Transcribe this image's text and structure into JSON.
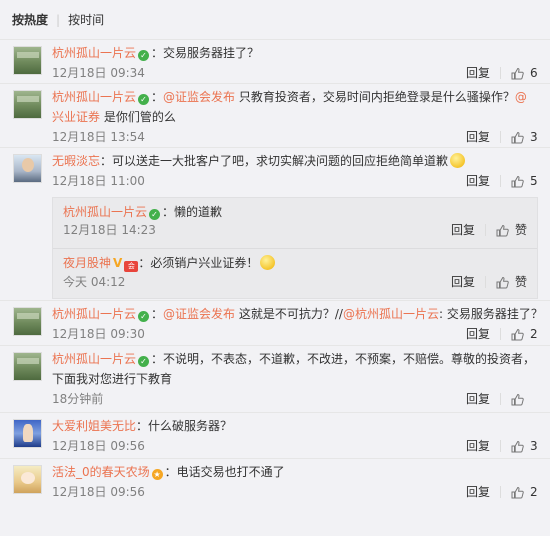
{
  "sort": {
    "hot": "按热度",
    "time": "按时间"
  },
  "comments": [
    {
      "name": "杭州孤山一片云",
      "content": "：交易服务器挂了？",
      "time": "12月18日 09:34",
      "reply": "回复",
      "likes": "6"
    },
    {
      "name": "杭州孤山一片云",
      "mention1": "@证监会发布",
      "content1": " 只教育投资者，交易时间内拒绝登录是什么骚操作？",
      "mention2": "@兴业证券",
      "content2": " 是你们管的么",
      "time": "12月18日 13:54",
      "reply": "回复",
      "likes": "3"
    },
    {
      "name": "无暇淡忘",
      "content": "：可以送走一大批客户了吧，求切实解决问题的回应拒绝简单道歉",
      "time": "12月18日 11:00",
      "reply": "回复",
      "likes": "5",
      "subs": [
        {
          "name": "杭州孤山一片云",
          "content": "：懒的道歉",
          "time": "12月18日 14:23",
          "reply": "回复",
          "like_label": "赞"
        },
        {
          "name": "夜月股神",
          "content": "：必须销户兴业证券！",
          "time": "今天 04:12",
          "reply": "回复",
          "like_label": "赞"
        }
      ]
    },
    {
      "name": "杭州孤山一片云",
      "mention1": "@证监会发布",
      "content1": " 这就是不可抗力？//",
      "mention2": "@杭州孤山一片云",
      "content2": ": 交易服务器挂了？",
      "time": "12月18日 09:30",
      "reply": "回复",
      "likes": "2"
    },
    {
      "name": "杭州孤山一片云",
      "content": "：不说明，不表态，不道歉，不改进，不预案，不赔偿。尊敬的投资者，下面我对您进行下教育",
      "time": "18分钟前",
      "reply": "回复",
      "likes": ""
    },
    {
      "name": "大爱利姐美无比",
      "content": "：什么破服务器？",
      "time": "12月18日 09:56",
      "reply": "回复",
      "likes": "3"
    },
    {
      "name": "活法_0的春天农场",
      "content": "：电话交易也打不通了",
      "time": "12月18日 09:56",
      "reply": "回复",
      "likes": "2"
    }
  ]
}
